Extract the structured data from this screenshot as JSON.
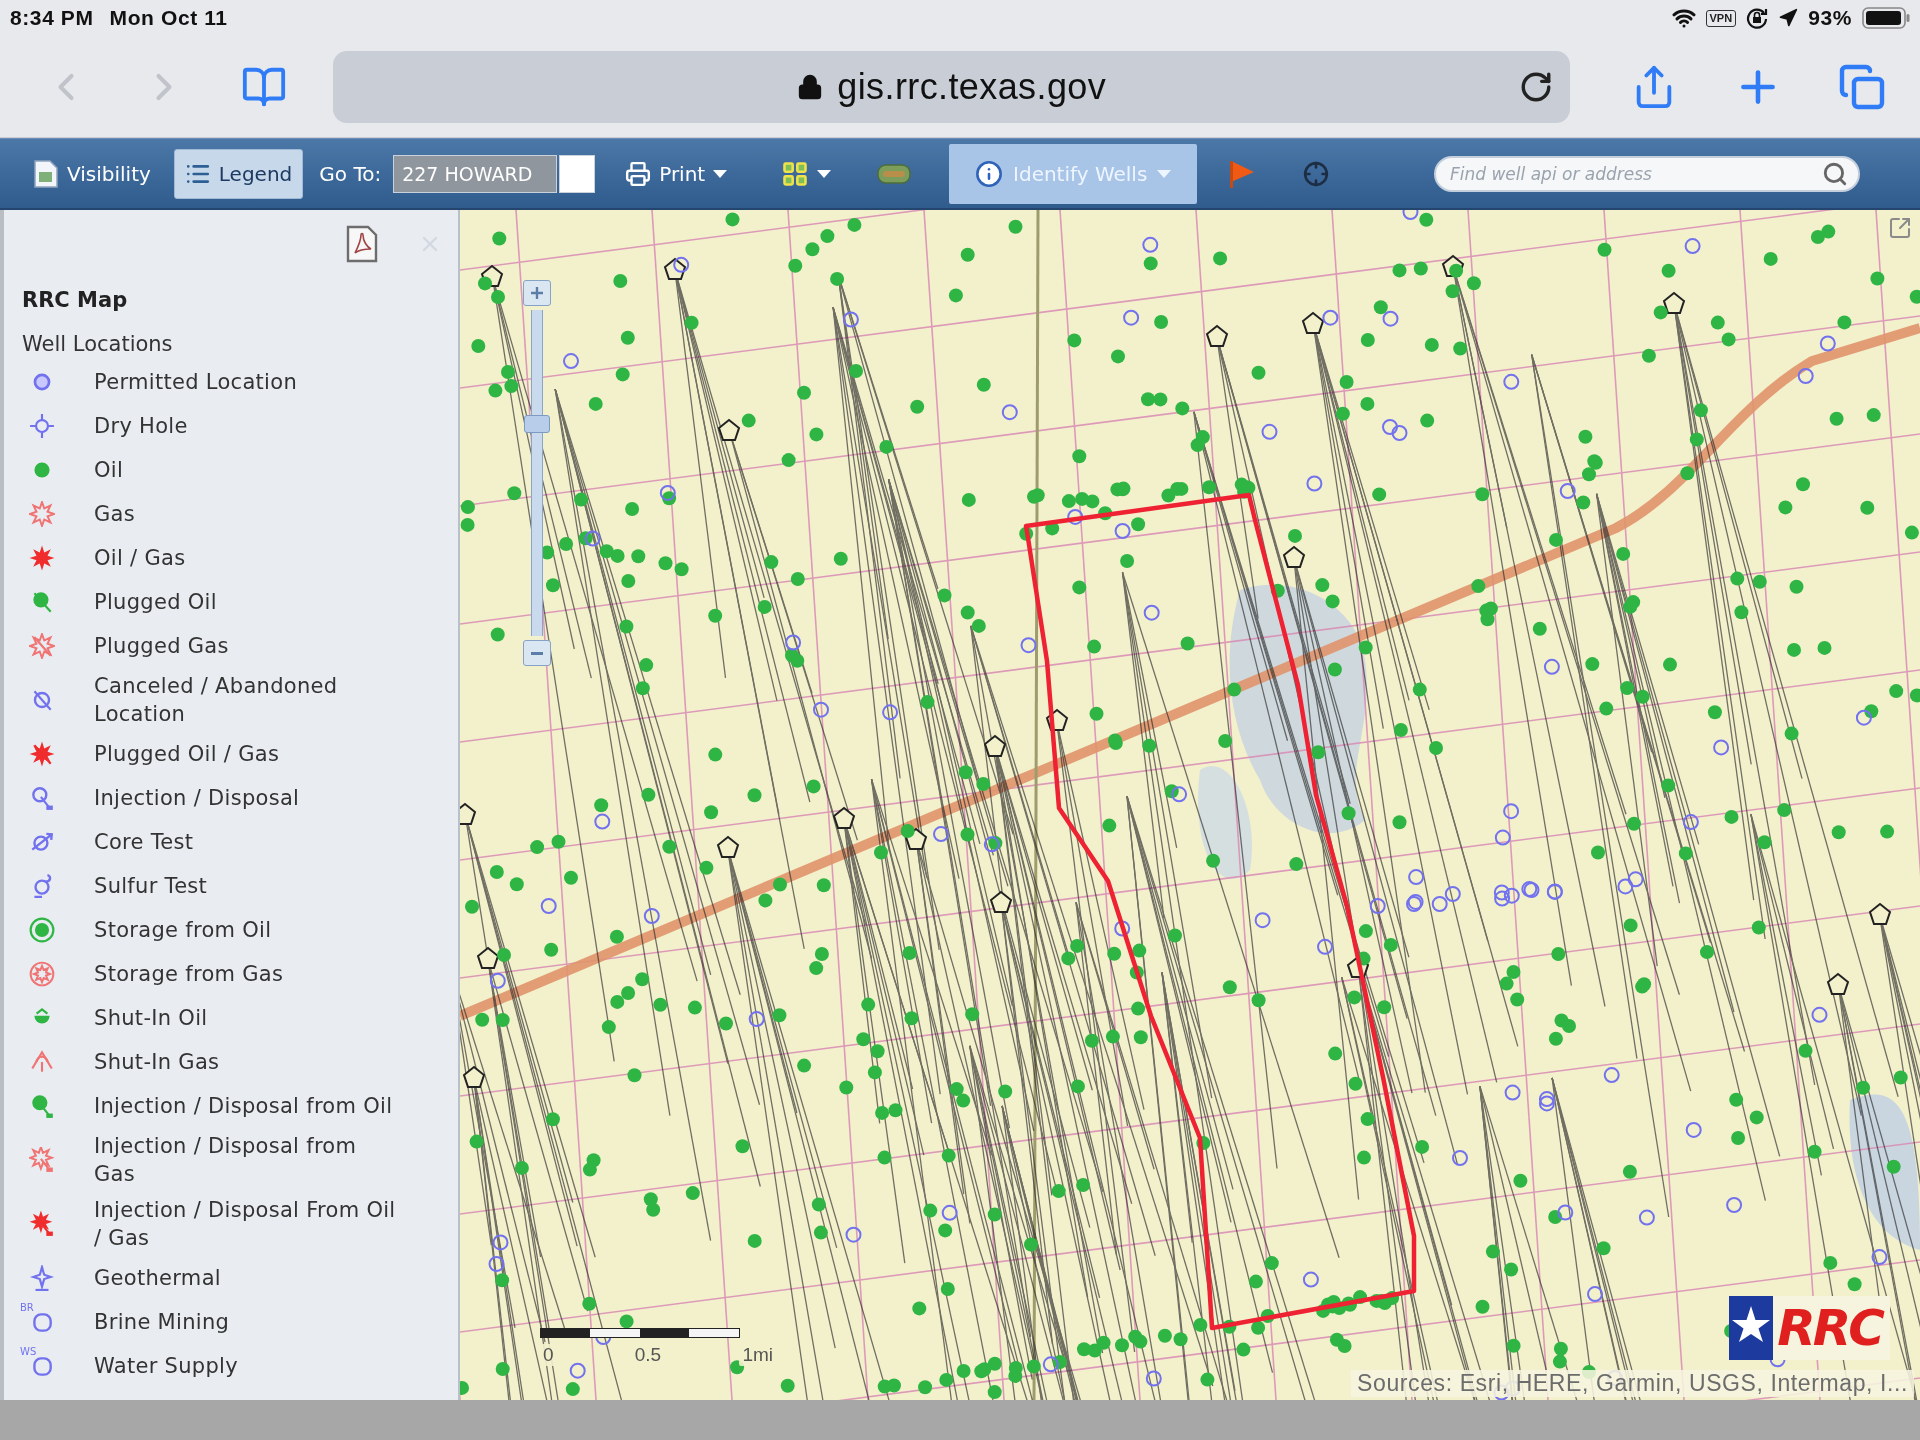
{
  "status_bar": {
    "time": "8:34 PM",
    "date": "Mon Oct 11",
    "vpn": "VPN",
    "battery": "93%"
  },
  "browser": {
    "back": {
      "disabled": true
    },
    "forward": {
      "disabled": true
    },
    "url": "gis.rrc.texas.gov"
  },
  "toolbar": {
    "toggles": [
      {
        "label": "Visibility",
        "kind": "layers",
        "selected": false
      },
      {
        "label": "Legend",
        "kind": "list",
        "selected": true
      }
    ],
    "goto": {
      "label": "Go To:",
      "value": "227 HOWARD"
    },
    "print": {
      "label": "Print"
    },
    "identify": {
      "label": "Identify Wells",
      "selected": true
    },
    "search": {
      "placeholder": "Find well api or address"
    }
  },
  "legend": {
    "title": "RRC Map",
    "section": "Well Locations",
    "items": [
      {
        "label": "Permitted Location",
        "kind": "ring",
        "color": "#7272ee"
      },
      {
        "label": "Dry Hole",
        "kind": "target",
        "color": "#7272ee"
      },
      {
        "label": "Oil",
        "kind": "dot",
        "color": "#2fb544"
      },
      {
        "label": "Gas",
        "kind": "star",
        "color": "#f07474"
      },
      {
        "label": "Oil / Gas",
        "kind": "starfill",
        "color": "#f02c2c"
      },
      {
        "label": "Plugged Oil",
        "kind": "dotslash",
        "color": "#2fb544"
      },
      {
        "label": "Plugged Gas",
        "kind": "starslash",
        "color": "#f07474"
      },
      {
        "label": "Canceled / Abandoned Location",
        "kind": "ringslash",
        "color": "#7272ee"
      },
      {
        "label": "Plugged Oil / Gas",
        "kind": "starfillslash",
        "color": "#f02c2c"
      },
      {
        "label": "Injection / Disposal",
        "kind": "ringinject",
        "color": "#7272ee"
      },
      {
        "label": "Core Test",
        "kind": "core",
        "color": "#7272ee"
      },
      {
        "label": "Sulfur Test",
        "kind": "sulfur",
        "color": "#7272ee"
      },
      {
        "label": "Storage from Oil",
        "kind": "storage",
        "color": "#2fb544"
      },
      {
        "label": "Storage from Gas",
        "kind": "storagering",
        "color": "#f07474"
      },
      {
        "label": "Shut-In Oil",
        "kind": "shutin",
        "color": "#2fb544"
      },
      {
        "label": "Shut-In Gas",
        "kind": "shutinstar",
        "color": "#f07474"
      },
      {
        "label": "Injection / Disposal from Oil",
        "kind": "dotinject",
        "color": "#2fb544"
      },
      {
        "label": "Injection / Disposal from Gas",
        "kind": "starinject",
        "color": "#f07474"
      },
      {
        "label": "Injection / Disposal From Oil / Gas",
        "kind": "starfillinject",
        "color": "#f02c2c"
      },
      {
        "label": "Geothermal",
        "kind": "geothermal",
        "color": "#7272ee"
      },
      {
        "label": "Brine Mining",
        "kind": "coded",
        "color": "#7272ee",
        "code": "BR"
      },
      {
        "label": "Water Supply",
        "kind": "coded",
        "color": "#7272ee",
        "code": "WS"
      }
    ]
  },
  "map": {
    "zoom_slider": {
      "level": 0.66
    },
    "scale_labels": [
      "0",
      "0.5",
      "1mi"
    ],
    "attribution": "Sources: Esri, HERE, Garmin, USGS, Intermap, I...",
    "logo": "RRC"
  }
}
